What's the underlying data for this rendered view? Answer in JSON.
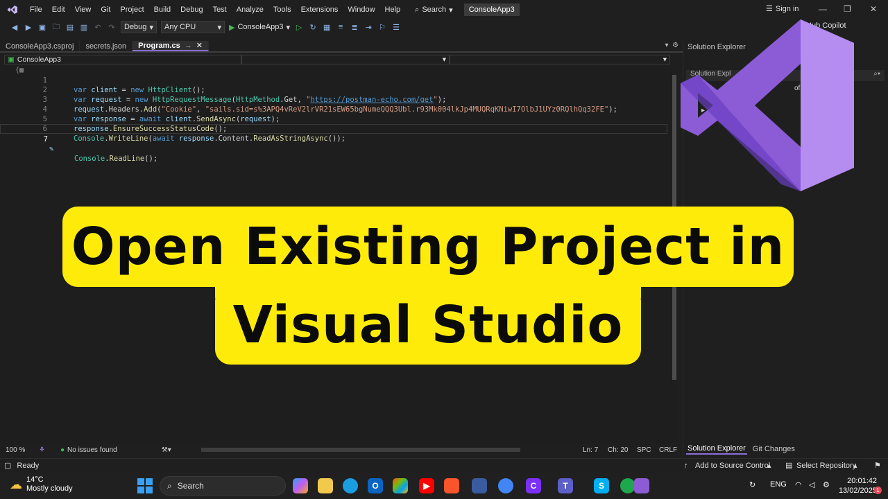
{
  "menu": {
    "items": [
      "File",
      "Edit",
      "View",
      "Git",
      "Project",
      "Build",
      "Debug",
      "Test",
      "Analyze",
      "Tools",
      "Extensions",
      "Window",
      "Help"
    ],
    "search_label": "Search",
    "project_name": "ConsoleApp3",
    "signin_label": "Sign in"
  },
  "toolbar": {
    "config": "Debug",
    "platform": "Any CPU",
    "start_target": "ConsoleApp3",
    "copilot_label": "GitHub Copilot"
  },
  "tabs": [
    {
      "label": "ConsoleApp3.csproj",
      "active": false
    },
    {
      "label": "secrets.json",
      "active": false
    },
    {
      "label": "Program.cs",
      "active": true
    }
  ],
  "navbar": {
    "project_scope": "ConsoleApp3"
  },
  "editor": {
    "lines": [
      {
        "n": "1"
      },
      {
        "n": "2",
        "url": "https://postman-echo.com/get"
      },
      {
        "n": "3",
        "cookie": "\"sails.sid=s%3APQ4vReV2lrVR21sEW65bgNumeQQQ3Ubl.r93Mk004lkJp4MUQRqKNiwI7OlbJ1UYz0RQlhQq32FE\""
      },
      {
        "n": "4"
      },
      {
        "n": "5"
      },
      {
        "n": "6"
      },
      {
        "n": "7"
      }
    ],
    "cookie_header": "\"Cookie\""
  },
  "editor_status": {
    "zoom": "100 %",
    "issues": "No issues found",
    "line": "Ln: 7",
    "col": "Ch: 20",
    "whitespace": "SPC",
    "line_ending": "CRLF"
  },
  "solution_explorer": {
    "title": "Solution Explorer",
    "search_partial": "Solution Expl",
    "solution_partial": "of 1 proj",
    "node_partial": "Co",
    "tabs": [
      "Solution Explorer",
      "Git Changes"
    ]
  },
  "statusbar": {
    "ready": "Ready",
    "source_control": "Add to Source Control",
    "repository": "Select Repository"
  },
  "taskbar": {
    "temperature": "14°C",
    "weather": "Mostly cloudy",
    "search": "Search",
    "language": "ENG",
    "time": "20:01:42",
    "date": "13/02/2025",
    "notification_count": "1"
  },
  "overlay": {
    "line1": "Open Existing Project in",
    "line2": "Visual Studio"
  },
  "colors": {
    "banner": "#ffeb0a",
    "vs_purple": "#8b5cd6",
    "accent": "#8b6fd6"
  }
}
